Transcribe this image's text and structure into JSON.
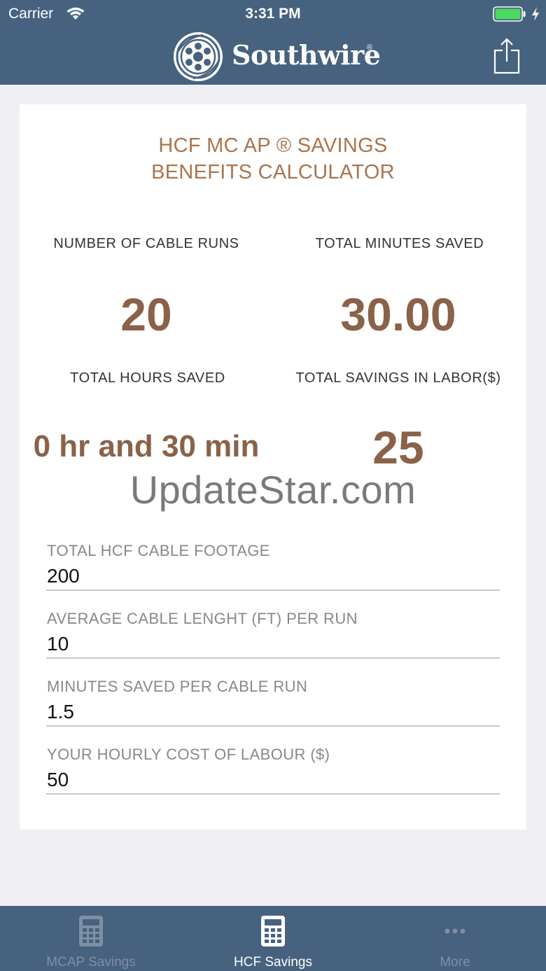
{
  "status_bar": {
    "carrier": "Carrier",
    "time": "3:31 PM"
  },
  "header": {
    "logo_text": "Southwire",
    "logo_mark": "®",
    "share_icon": "share-icon"
  },
  "calculator": {
    "title_line1": "HCF MC AP ® SAVINGS",
    "title_line2": "BENEFITS CALCULATOR",
    "stats": {
      "cable_runs_label": "NUMBER OF CABLE RUNS",
      "cable_runs_value": "20",
      "minutes_saved_label": "TOTAL MINUTES SAVED",
      "minutes_saved_value": "30.00",
      "hours_saved_label": "TOTAL HOURS SAVED",
      "hours_saved_value": "0 hr and 30 min",
      "labor_savings_label": "TOTAL SAVINGS IN LABOR($)",
      "labor_savings_value": "25"
    },
    "watermark": "UpdateStar.com",
    "fields": [
      {
        "label": "TOTAL HCF CABLE FOOTAGE",
        "value": "200"
      },
      {
        "label": "AVERAGE CABLE LENGHT (FT) PER RUN",
        "value": "10"
      },
      {
        "label": "MINUTES SAVED PER CABLE RUN",
        "value": "1.5"
      },
      {
        "label": "YOUR HOURLY COST OF LABOUR ($)",
        "value": "50"
      }
    ]
  },
  "tabs": [
    {
      "label": "MCAP Savings",
      "icon": "calculator-icon",
      "active": false
    },
    {
      "label": "HCF Savings",
      "icon": "calculator-icon",
      "active": true
    },
    {
      "label": "More",
      "icon": "more-dots-icon",
      "active": false
    }
  ],
  "colors": {
    "bar_background": "#46627f",
    "title_color": "#a8754f",
    "value_color": "#8a6248",
    "battery_green": "#4cd964"
  }
}
